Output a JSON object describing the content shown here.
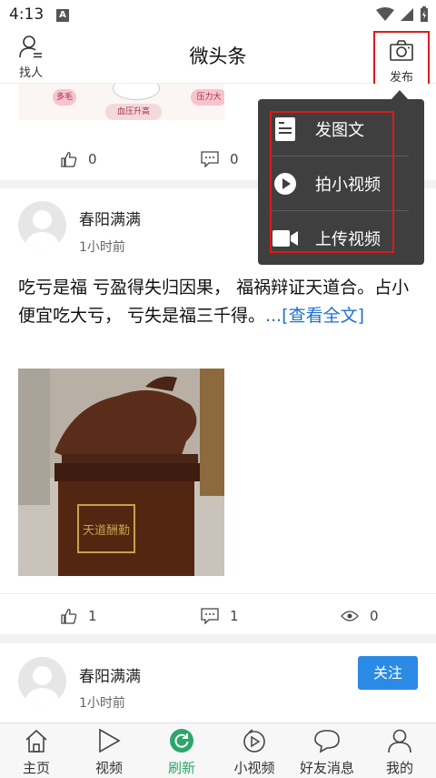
{
  "status_bar": {
    "time": "4:13",
    "app_badge": "A"
  },
  "header": {
    "title": "微头条",
    "find_label": "找人",
    "publish_label": "发布"
  },
  "feed": {
    "card1": {
      "image_tags": [
        "多毛",
        "血压升高",
        "压力大"
      ],
      "like_count": "0",
      "comment_count": "0"
    },
    "card2": {
      "author": "春阳满满",
      "time": "1小时前",
      "text": "吃亏是福 亏盈得失归因果， 福祸辩证天道合。占小便宜吃大亏， 亏失是福三千得。",
      "more_link": "...[查看全文]",
      "image_caption": "天道酬勤",
      "like_count": "1",
      "comment_count": "1",
      "view_count": "0"
    },
    "card3": {
      "author": "春阳满满",
      "time": "1小时前",
      "follow_label": "关注"
    }
  },
  "popup_menu": {
    "items": [
      {
        "label": "发图文",
        "icon": "image-text-icon"
      },
      {
        "label": "拍小视频",
        "icon": "short-video-icon"
      },
      {
        "label": "上传视频",
        "icon": "video-camera-icon"
      }
    ]
  },
  "bottom_nav": {
    "items": [
      {
        "label": "主页",
        "icon": "home-icon"
      },
      {
        "label": "视频",
        "icon": "play-icon"
      },
      {
        "label": "刷新",
        "icon": "refresh-icon",
        "active": true
      },
      {
        "label": "小视频",
        "icon": "small-video-icon"
      },
      {
        "label": "好友消息",
        "icon": "chat-bubble-icon"
      },
      {
        "label": "我的",
        "icon": "user-icon"
      }
    ]
  },
  "colors": {
    "accent_green": "#2ca66b",
    "link_blue": "#1e6fd0",
    "follow_blue": "#2a8ae6",
    "highlight_red": "#e0191a",
    "popup_bg": "#3f3f3f"
  }
}
